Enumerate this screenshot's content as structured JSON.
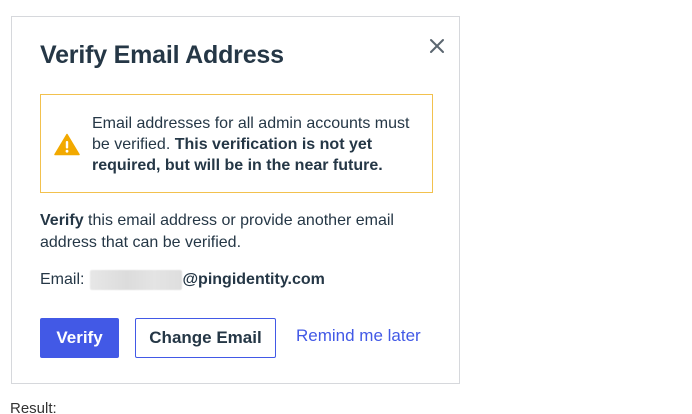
{
  "modal": {
    "title": "Verify Email Address",
    "close_icon": "close-icon",
    "warning": {
      "icon": "warning-triangle-icon",
      "icon_color": "#f2a900",
      "border_color": "#f2c14e",
      "text_plain": "Email addresses for all admin accounts must be verified.",
      "text_bold": "This verification is not yet required, but will be in the near future."
    },
    "body": {
      "bold_lead": "Verify",
      "rest": "this email address or provide another email address that can be verified."
    },
    "email": {
      "label": "Email:",
      "domain": "@pingidentity.com"
    },
    "buttons": {
      "verify_label": "Verify",
      "change_label": "Change Email",
      "remind_label": "Remind me later"
    },
    "accent_color": "#4259e6"
  },
  "footer": {
    "result_label": "Result:"
  }
}
